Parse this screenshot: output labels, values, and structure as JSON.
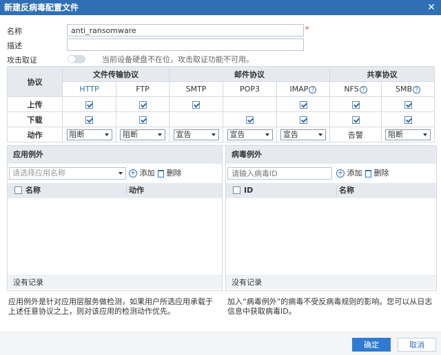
{
  "window": {
    "title": "新建反病毒配置文件"
  },
  "form": {
    "name_label": "名称",
    "name_value": "anti_ransomware",
    "required_mark": "*",
    "desc_label": "描述",
    "desc_value": "",
    "attack_label": "攻击取证",
    "attack_hint": "当前设备硬盘不在位，攻击取证功能不可用。"
  },
  "protocols": {
    "corner": "协议",
    "groups": [
      "文件传输协议",
      "邮件协议",
      "共享协议"
    ],
    "columns": [
      "HTTP",
      "FTP",
      "SMTP",
      "POP3",
      "IMAP",
      "NFS",
      "SMB"
    ],
    "upload_label": "上传",
    "download_label": "下载",
    "action_label": "动作",
    "actions": [
      "阻断",
      "阻断",
      "宣告",
      "宣告",
      "宣告",
      "告警",
      "阻断"
    ]
  },
  "app_exception": {
    "title": "应用例外",
    "select_placeholder": "请选择应用名称",
    "add_label": "添加",
    "delete_label": "删除",
    "col_name": "名称",
    "col_action": "动作",
    "empty": "没有记录",
    "note": "应用例外是针对应用层服务做检测，如果用户所选应用承载于上述任意协议之上，则对该应用的检测动作优先。"
  },
  "virus_exception": {
    "title": "病毒例外",
    "input_placeholder": "请输入病毒ID",
    "add_label": "添加",
    "delete_label": "删除",
    "col_id": "ID",
    "col_name": "名称",
    "empty": "没有记录",
    "note": "加入“病毒例外”的病毒不受反病毒规则的影响。您可以从日志信息中获取病毒ID。"
  },
  "buttons": {
    "ok": "确定",
    "cancel": "取消"
  },
  "colors": {
    "title_bar": "#2f6fb6",
    "primary": "#2f7bd1",
    "required": "#e0302b"
  }
}
